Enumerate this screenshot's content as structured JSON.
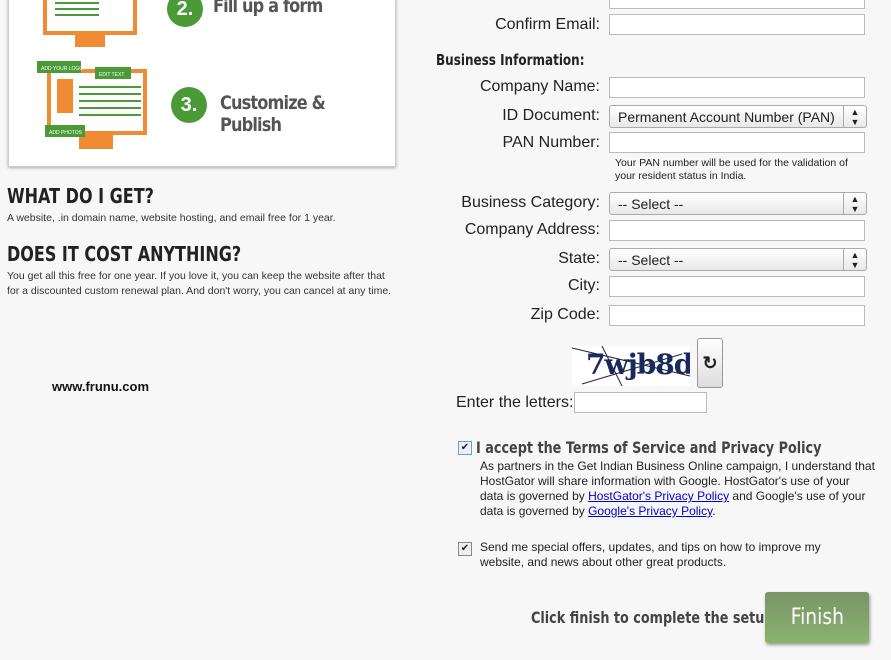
{
  "left": {
    "steps": [
      {
        "number": "2.",
        "label": "Fill up a form"
      },
      {
        "number": "3.",
        "label": "Customize & Publish"
      }
    ],
    "illustration": {
      "logo_tag": "ADD YOUR LOGO",
      "text_tag": "EDIT TEXT",
      "photos_tag": "ADD PHOTOS"
    },
    "what_heading": "WHAT DO I GET?",
    "what_text": "A website, .in domain name, website hosting, and email free for 1 year.",
    "cost_heading": "DOES IT COST ANYTHING?",
    "cost_text": "You get all this free for one year. If you love it, you can keep the website after that for a discounted custom renewal plan. And don't worry, you can cancel at any time.",
    "watermark": "www.frunu.com"
  },
  "form": {
    "confirm_email_label": "Confirm Email:",
    "section_title": "Business Information:",
    "company_name_label": "Company Name:",
    "id_document_label": "ID Document:",
    "id_document_value": "Permanent Account Number (PAN)",
    "pan_label": "PAN Number:",
    "pan_hint": "Your PAN number will be used for the validation of your resident status in India.",
    "category_label": "Business Category:",
    "category_value": "-- Select --",
    "address_label": "Company Address:",
    "state_label": "State:",
    "state_value": "-- Select --",
    "city_label": "City:",
    "zip_label": "Zip Code:",
    "captcha_text": "7wjb8d",
    "captcha_label": "Enter the letters:",
    "accept_label": "I accept the Terms of Service and Privacy Policy",
    "accept_checked": true,
    "accept_text_1": "As partners in the Get Indian Business Online campaign, I understand that HostGator will share information with Google. HostGator's use of your data is governed by ",
    "hostgator_link": "HostGator's Privacy Policy",
    "accept_text_2": " and Google's use of your data is governed by ",
    "google_link": "Google's Privacy Policy",
    "accept_text_3": ".",
    "offers_label": "Send me special offers, updates, and tips on how to improve my website, and news about other great products.",
    "offers_checked": true,
    "finish_prompt": "Click finish to complete the setup.",
    "finish_button": "Finish"
  },
  "colors": {
    "accent_green": "#4a9a38",
    "orange": "#f08a33",
    "finish_button": "#7fa56e"
  }
}
